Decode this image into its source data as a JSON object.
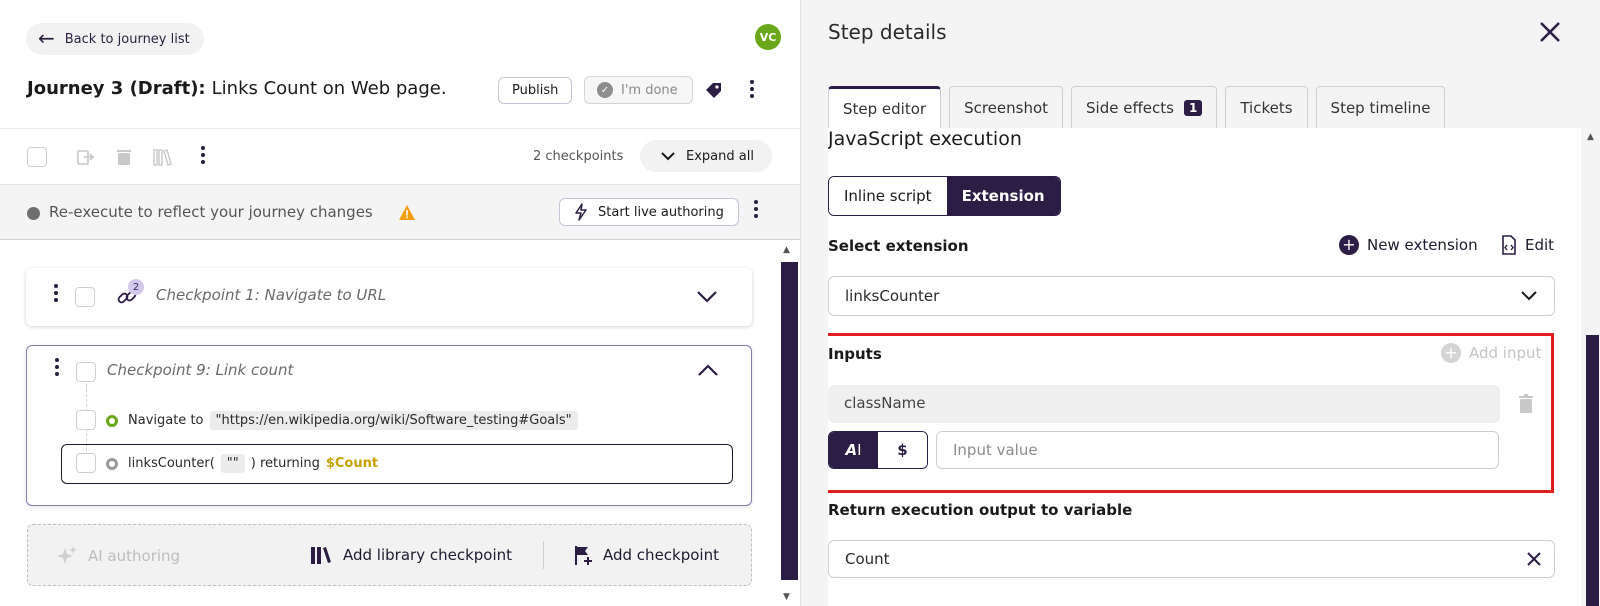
{
  "header": {
    "back_label": "Back to journey list",
    "avatar_initials": "VC",
    "journey_prefix": "Journey 3 (Draft):",
    "journey_name": "Links Count on Web page.",
    "publish_label": "Publish",
    "done_label": "I'm done"
  },
  "toolbar": {
    "checkpoints_count": "2 checkpoints",
    "expand_label": "Expand all"
  },
  "reexecute": {
    "message": "Re-execute to reflect your journey changes",
    "live_label": "Start live authoring"
  },
  "checkpoints": [
    {
      "title": "Checkpoint 1:  Navigate to URL",
      "badge": "2"
    },
    {
      "title": "Checkpoint 9:  Link count",
      "steps": [
        {
          "prefix": "Navigate to",
          "chip": "\"https://en.wikipedia.org/wiki/Software_testing#Goals\"",
          "dot_color": "#6aa71a"
        },
        {
          "prefix": "linksCounter(",
          "chip": "\"\"",
          "middle": ") returning",
          "variable": "$Count",
          "dot_color": "#9a9a9a"
        }
      ]
    }
  ],
  "add_area": {
    "ai_label": "AI authoring",
    "library_label": "Add library checkpoint",
    "add_label": "Add checkpoint"
  },
  "panel": {
    "title": "Step details",
    "tabs": [
      {
        "label": "Step editor",
        "active": true
      },
      {
        "label": "Screenshot"
      },
      {
        "label": "Side effects",
        "badge": "1"
      },
      {
        "label": "Tickets"
      },
      {
        "label": "Step timeline"
      }
    ],
    "section_title": "JavaScript execution",
    "script_modes": [
      "Inline script",
      "Extension"
    ],
    "select_label": "Select extension",
    "new_extension_label": "New extension",
    "edit_label": "Edit",
    "selected_extension": "linksCounter",
    "inputs_label": "Inputs",
    "add_input_label": "Add input",
    "param_name": "className",
    "type_options": [
      "A",
      "$"
    ],
    "input_placeholder": "Input value",
    "return_label": "Return execution output to variable",
    "return_value": "Count"
  },
  "colors": {
    "brand": "#2b1d44",
    "highlight": "#e01e1e",
    "variable": "#c7a100",
    "warning": "#f39c12"
  }
}
